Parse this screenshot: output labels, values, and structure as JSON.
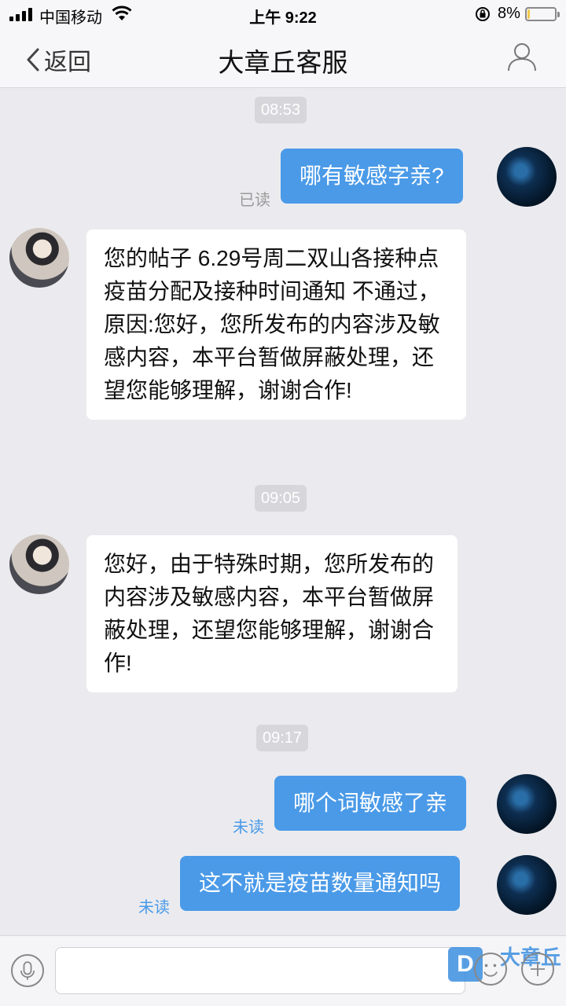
{
  "status_bar": {
    "carrier": "中国移动",
    "time": "上午 9:22",
    "battery_percent": "8%",
    "battery_level": 0.08,
    "icons": [
      "signal-icon",
      "wifi-icon",
      "rotation-lock-icon",
      "battery-icon"
    ]
  },
  "nav": {
    "back_label": "返回",
    "title": "大章丘客服",
    "icons": [
      "chevron-left-icon",
      "profile-icon"
    ]
  },
  "messages": {
    "t1": "08:53",
    "m1": {
      "sender": "me",
      "text": "哪有敏感字亲?",
      "status": "已读"
    },
    "m2": {
      "sender": "agent",
      "text": "您的帖子 6.29号周二双山各接种点疫苗分配及接种时间通知 不通过，原因:您好，您所发布的内容涉及敏感内容，本平台暂做屏蔽处理，还望您能够理解，谢谢合作!"
    },
    "t2": "09:05",
    "m3": {
      "sender": "agent",
      "text": "您好，由于特殊时期，您所发布的内容涉及敏感内容，本平台暂做屏蔽处理，还望您能够理解，谢谢合作!"
    },
    "t3": "09:17",
    "m4": {
      "sender": "me",
      "text": "哪个词敏感了亲",
      "status": "未读"
    },
    "m5": {
      "sender": "me",
      "text": "这不就是疫苗数量通知吗",
      "status": "未读"
    }
  },
  "input_bar": {
    "text_value": "",
    "icons": [
      "microphone-icon",
      "emoji-icon",
      "plus-icon"
    ]
  },
  "watermark": {
    "badge": "D",
    "text": "大章丘"
  },
  "colors": {
    "outgoing_bubble": "#4a9ae8",
    "incoming_bubble": "#ffffff",
    "background": "#ebebef",
    "unread_status": "#4a9ae8"
  }
}
